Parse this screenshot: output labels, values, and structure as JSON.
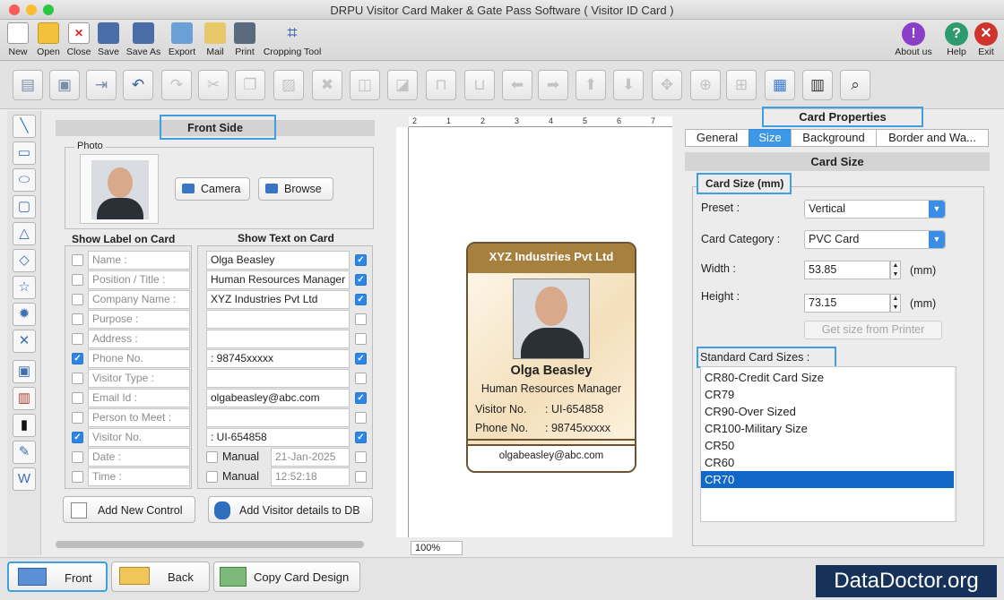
{
  "window": {
    "title": "DRPU Visitor Card Maker & Gate Pass Software ( Visitor ID Card )"
  },
  "main_toolbar": {
    "new": "New",
    "open": "Open",
    "close": "Close",
    "save": "Save",
    "save_as": "Save As",
    "export": "Export",
    "mail": "Mail",
    "print": "Print",
    "cropping_tool": "Cropping Tool",
    "about_us": "About us",
    "help": "Help",
    "exit": "Exit"
  },
  "front_side": {
    "title": "Front Side",
    "photo_label": "Photo",
    "camera_label": "Camera",
    "browse_label": "Browse",
    "show_label_header": "Show Label on Card",
    "show_text_header": "Show Text on Card",
    "rows": [
      {
        "label": "Name :",
        "label_checked": false,
        "text": "Olga Beasley",
        "text_checked": true
      },
      {
        "label": "Position / Title :",
        "label_checked": false,
        "text": "Human Resources Manager",
        "text_checked": true
      },
      {
        "label": "Company Name :",
        "label_checked": false,
        "text": "XYZ Industries Pvt Ltd",
        "text_checked": true
      },
      {
        "label": "Purpose :",
        "label_checked": false,
        "text": "",
        "text_checked": false
      },
      {
        "label": "Address :",
        "label_checked": false,
        "text": "",
        "text_checked": false
      },
      {
        "label": "Phone No.",
        "label_checked": true,
        "text": ": 98745xxxxx",
        "text_checked": true
      },
      {
        "label": "Visitor Type :",
        "label_checked": false,
        "text": "",
        "text_checked": false
      },
      {
        "label": "Email Id :",
        "label_checked": false,
        "text": "olgabeasley@abc.com",
        "text_checked": true
      },
      {
        "label": "Person to Meet :",
        "label_checked": false,
        "text": "",
        "text_checked": false
      },
      {
        "label": "Visitor No.",
        "label_checked": true,
        "text": ": UI-654858",
        "text_checked": true
      }
    ],
    "date_row": {
      "label": "Date :",
      "manual": "Manual",
      "value": "21-Jan-2025"
    },
    "time_row": {
      "label": "Time :",
      "manual": "Manual",
      "value": "12:52:18"
    },
    "add_control": "Add New Control",
    "add_visitor": "Add Visitor details to DB"
  },
  "canvas": {
    "zoom": "100%",
    "ruler_top": [
      "2",
      "1",
      "2",
      "3",
      "4",
      "5",
      "6",
      "7"
    ],
    "card": {
      "company": "XYZ Industries Pvt Ltd",
      "name": "Olga Beasley",
      "position": "Human Resources Manager",
      "visitor_label": "Visitor No.",
      "visitor_value": ": UI-654858",
      "phone_label": "Phone No.",
      "phone_value": ": 98745xxxxx",
      "email": "olgabeasley@abc.com"
    }
  },
  "card_properties": {
    "title": "Card Properties",
    "tabs": [
      "General",
      "Size",
      "Background",
      "Border and Wa..."
    ],
    "active_tab": "Size",
    "section_title": "Card Size",
    "group_title": "Card Size (mm)",
    "preset_label": "Preset :",
    "preset_value": "Vertical",
    "category_label": "Card Category :",
    "category_value": "PVC Card",
    "width_label": "Width :",
    "width_value": "53.85",
    "height_label": "Height :",
    "height_value": "73.15",
    "unit": "(mm)",
    "get_size": "Get size from Printer",
    "standard_label": "Standard Card Sizes :",
    "standard_sizes": [
      "CR80-Credit Card Size",
      "CR79",
      "CR90-Over Sized",
      "CR100-Military Size",
      "CR50",
      "CR60",
      "CR70"
    ],
    "selected_size": "CR70"
  },
  "bottom": {
    "front": "Front",
    "back": "Back",
    "copy": "Copy Card Design",
    "brand": "DataDoctor.org"
  },
  "colors": {
    "accent": "#3e98e8",
    "card_header": "#a6803f",
    "brand_bg": "#16325a"
  }
}
